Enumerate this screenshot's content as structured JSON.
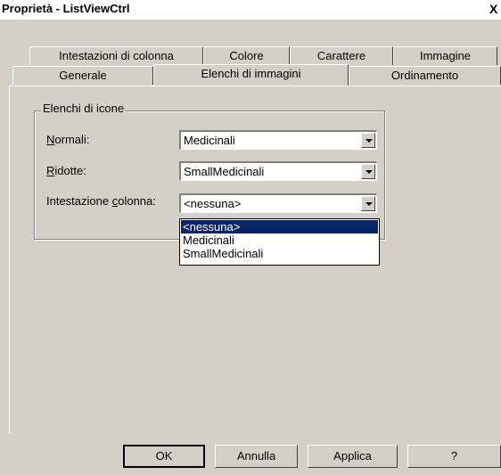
{
  "window": {
    "title": "Proprietà - ListViewCtrl",
    "close_label": "X"
  },
  "tabs_back": [
    {
      "label": "Intestazioni di colonna"
    },
    {
      "label": "Colore"
    },
    {
      "label": "Carattere"
    },
    {
      "label": "Immagine"
    }
  ],
  "tabs_front": [
    {
      "label": "Generale"
    },
    {
      "label": "Elenchi di immagini",
      "active": true
    },
    {
      "label": "Ordinamento"
    }
  ],
  "group": {
    "title": "Elenchi di icone",
    "fields": [
      {
        "label_mnemonic": "N",
        "label_rest": "ormali:",
        "value": "Medicinali"
      },
      {
        "label_mnemonic": "R",
        "label_rest": "idotte:",
        "value": "SmallMedicinali"
      },
      {
        "label_prefix": "Intestazione ",
        "label_mnemonic": "c",
        "label_rest": "olonna:",
        "value": "<nessuna>"
      }
    ]
  },
  "dropdown": {
    "options": [
      "<nessuna>",
      "Medicinali",
      "SmallMedicinali"
    ],
    "selected_index": 0
  },
  "buttons": {
    "ok": "OK",
    "cancel": "Annulla",
    "apply": "Applica",
    "help": "?"
  },
  "colors": {
    "face": "#d4d0c8",
    "selection": "#0a246a"
  }
}
